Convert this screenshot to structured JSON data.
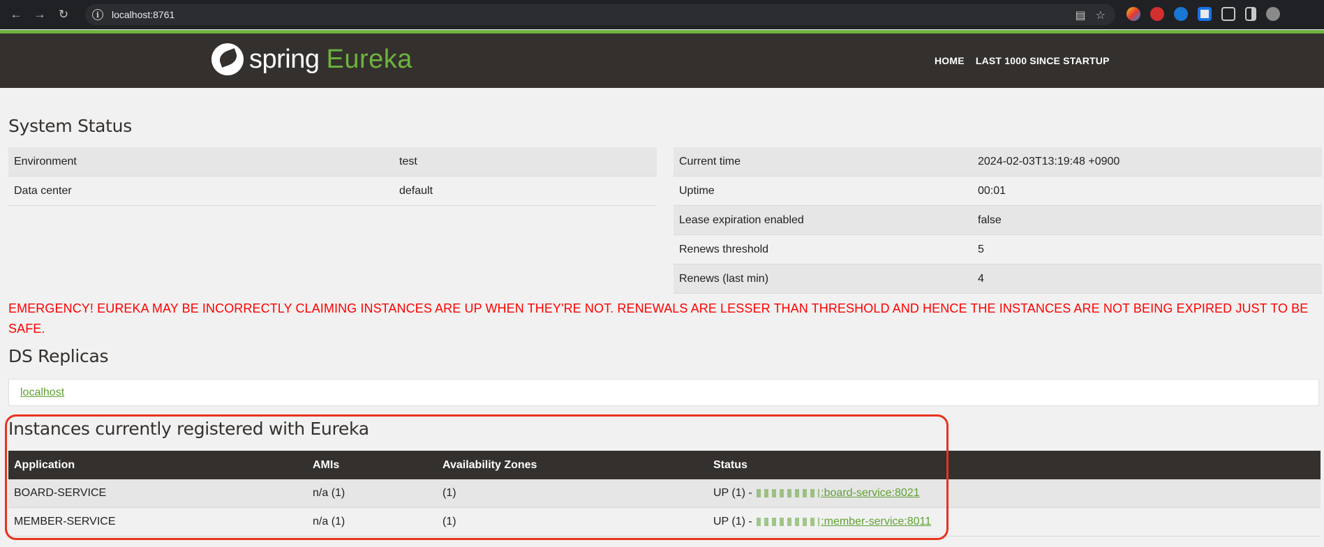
{
  "browser": {
    "url": "localhost:8761"
  },
  "header": {
    "brand_spring": "spring",
    "brand_eureka": "Eureka",
    "links": [
      "HOME",
      "LAST 1000 SINCE STARTUP"
    ],
    "accent": "#6db33f",
    "nav_bg": "#34302d"
  },
  "system_status": {
    "title": "System Status",
    "left": [
      {
        "key": "Environment",
        "value": "test"
      },
      {
        "key": "Data center",
        "value": "default"
      }
    ],
    "right": [
      {
        "key": "Current time",
        "value": "2024-02-03T13:19:48 +0900"
      },
      {
        "key": "Uptime",
        "value": "00:01"
      },
      {
        "key": "Lease expiration enabled",
        "value": "false"
      },
      {
        "key": "Renews threshold",
        "value": "5"
      },
      {
        "key": "Renews (last min)",
        "value": "4"
      }
    ]
  },
  "emergency": "EMERGENCY! EUREKA MAY BE INCORRECTLY CLAIMING INSTANCES ARE UP WHEN THEY'RE NOT. RENEWALS ARE LESSER THAN THRESHOLD AND HENCE THE INSTANCES ARE NOT BEING EXPIRED JUST TO BE SAFE.",
  "ds_replicas": {
    "title": "DS Replicas",
    "link": "localhost"
  },
  "instances": {
    "title": "Instances currently registered with Eureka",
    "columns": [
      "Application",
      "AMIs",
      "Availability Zones",
      "Status"
    ],
    "rows": [
      {
        "application": "BOARD-SERVICE",
        "amis": "n/a (1)",
        "zones": "(1)",
        "status_prefix": "UP (1) -",
        "status_link": ":board-service:8021"
      },
      {
        "application": "MEMBER-SERVICE",
        "amis": "n/a (1)",
        "zones": "(1)",
        "status_prefix": "UP (1) -",
        "status_link": ":member-service:8011"
      }
    ]
  }
}
